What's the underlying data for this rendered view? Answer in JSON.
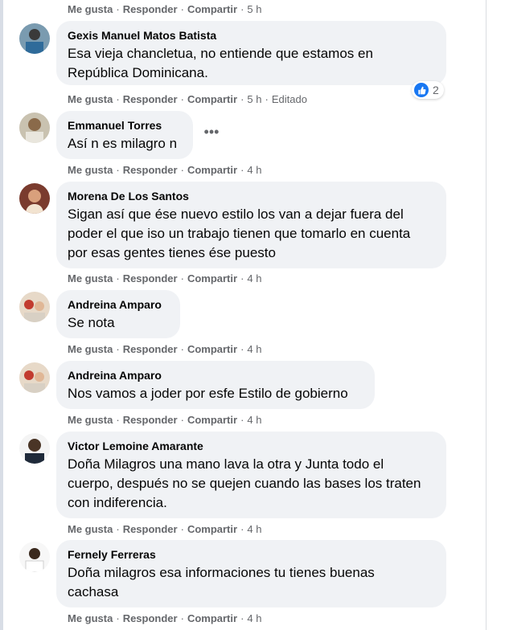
{
  "actions": {
    "like": "Me gusta",
    "reply": "Responder",
    "share": "Compartir",
    "separator": "·"
  },
  "top_actions": {
    "time": "5 h"
  },
  "comments": [
    {
      "author": "Gexis Manuel Matos Batista",
      "text": "Esa vieja chancletua, no entiende que estamos en\nRepública Dominicana.",
      "time": "5 h",
      "edited": "Editado",
      "reactions": {
        "icon": "like-icon",
        "count": "2"
      }
    },
    {
      "author": "Emmanuel Torres",
      "text": "Así n es milagro n",
      "time": "4 h"
    },
    {
      "author": "Morena De Los Santos",
      "text": "Sigan así que ése nuevo estilo los van a dejar fuera del\npoder el que iso un trabajo tienen que tomarlo en cuenta\npor esas gentes tienes ése puesto",
      "time": "4 h"
    },
    {
      "author": "Andreina Amparo",
      "text": "Se nota",
      "time": "4 h"
    },
    {
      "author": "Andreina Amparo",
      "text": "Nos vamos a joder por esfe Estilo de gobierno",
      "time": "4 h"
    },
    {
      "author": "Victor Lemoine Amarante",
      "text": "Doña Milagros una mano lava la otra y Junta todo el\ncuerpo, después no se quejen cuando las bases los traten\ncon indiferencia.",
      "time": "4 h"
    },
    {
      "author": "Fernely Ferreras",
      "text": "Doña milagros esa informaciones tu tienes buenas\ncachasa",
      "time": "4 h"
    }
  ],
  "colors": {
    "bubble": "#f0f2f5",
    "meta": "#65676b",
    "text": "#050505",
    "like": "#1877f2"
  },
  "icons": {
    "more": "more-options-icon"
  }
}
